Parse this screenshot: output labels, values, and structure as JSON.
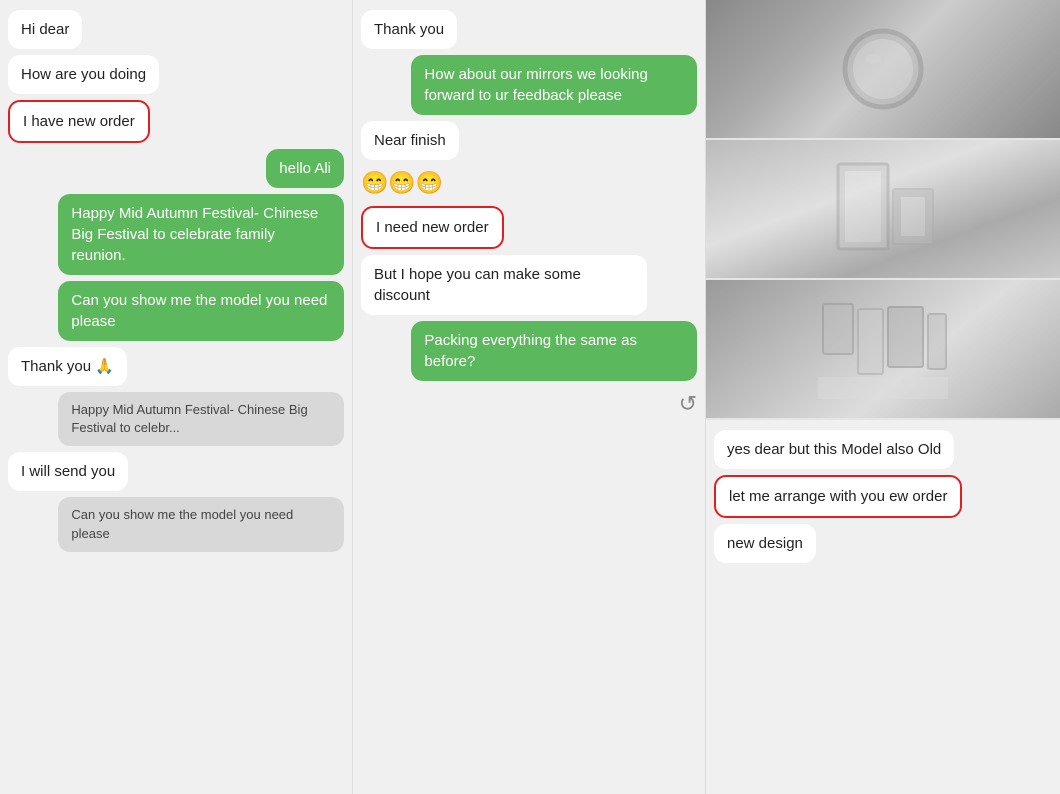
{
  "column1": {
    "messages": [
      {
        "id": "hi-dear",
        "text": "Hi dear",
        "type": "received"
      },
      {
        "id": "how-are-you",
        "text": "How are you doing",
        "type": "received"
      },
      {
        "id": "new-order",
        "text": "I have new order",
        "type": "highlighted"
      },
      {
        "id": "hello-ali",
        "text": "hello Ali",
        "type": "sent"
      },
      {
        "id": "festival",
        "text": "Happy Mid Autumn Festival- Chinese Big Festival to celebrate family reunion.",
        "type": "sent"
      },
      {
        "id": "show-model",
        "text": "Can you show me the model you need please",
        "type": "sent"
      },
      {
        "id": "thank-you-pray",
        "text": "Thank you 🙏",
        "type": "received"
      },
      {
        "id": "festival-preview",
        "text": "Happy Mid Autumn Festival- Chinese Big Festival to celebr...",
        "type": "gray-sent"
      },
      {
        "id": "will-send",
        "text": "I will send you",
        "type": "received"
      },
      {
        "id": "show-model-preview",
        "text": "Can you show me the model you need please",
        "type": "gray-sent"
      }
    ]
  },
  "column2": {
    "messages": [
      {
        "id": "thank-you",
        "text": "Thank you",
        "type": "received"
      },
      {
        "id": "how-about-mirrors",
        "text": "How about our mirrors we looking forward to ur feedback please",
        "type": "sent"
      },
      {
        "id": "near-finish",
        "text": "Near finish",
        "type": "received"
      },
      {
        "id": "emoji-row",
        "text": "😁😁😁",
        "type": "emoji"
      },
      {
        "id": "need-new-order",
        "text": "I need new order",
        "type": "highlighted"
      },
      {
        "id": "hope-discount",
        "text": "But I hope you can make some discount",
        "type": "received"
      },
      {
        "id": "packing-same",
        "text": "Packing everything the same as before?",
        "type": "sent"
      },
      {
        "id": "scroll-icon",
        "text": "⟳",
        "type": "scroll"
      }
    ]
  },
  "column3": {
    "photos": [
      {
        "id": "photo1",
        "style": "round-mirror"
      },
      {
        "id": "photo2",
        "style": "frame-mirror"
      },
      {
        "id": "photo3",
        "style": "showroom"
      }
    ],
    "messages": [
      {
        "id": "yes-dear",
        "text": "yes dear but this Model also Old",
        "type": "received"
      },
      {
        "id": "arrange-order",
        "text": "let me arrange with you ew order",
        "type": "highlighted-right"
      },
      {
        "id": "new-design",
        "text": "new design",
        "type": "received"
      }
    ]
  }
}
